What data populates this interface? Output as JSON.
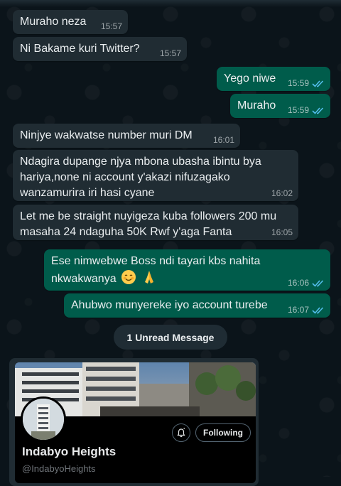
{
  "messages": [
    {
      "dir": "in",
      "text": "Muraho neza",
      "time": "15:57"
    },
    {
      "dir": "in",
      "text": "Ni Bakame kuri Twitter?",
      "time": "15:57"
    },
    {
      "dir": "out",
      "text": "Yego niwe",
      "time": "15:59"
    },
    {
      "dir": "out",
      "text": "Muraho",
      "time": "15:59"
    },
    {
      "dir": "in",
      "text": "Ninjye wakwatse number muri DM",
      "time": "16:01"
    },
    {
      "dir": "in",
      "text": "Ndagira dupange njya mbona ubasha ibintu bya hariya,none ni account y'akazi nifuzagako wanzamurira iri hasi cyane",
      "time": "16:02"
    },
    {
      "dir": "in",
      "text": "Let me be straight nuyigeza kuba followers 200 mu masaha 24 ndaguha 50K Rwf y'aga Fanta",
      "time": "16:05"
    },
    {
      "dir": "out",
      "text": "Ese nimwebwe Boss ndi tayari kbs nahita nkwakwanya",
      "time": "16:06",
      "emojis": [
        "smiling-face",
        "folded-hands"
      ]
    },
    {
      "dir": "out",
      "text": "Ahubwo munyereke iyo account turebe",
      "time": "16:07"
    }
  ],
  "unread_label": "1 Unread Message",
  "link_preview": {
    "name": "Indabyo Heights",
    "handle": "@IndabyoHeights",
    "follow_label": "Following",
    "bell_icon": "notification-bell-icon"
  },
  "colors": {
    "background": "#0b141a",
    "incoming_bubble": "#202c33",
    "outgoing_bubble": "#005c4b",
    "read_ticks": "#53bdeb"
  }
}
